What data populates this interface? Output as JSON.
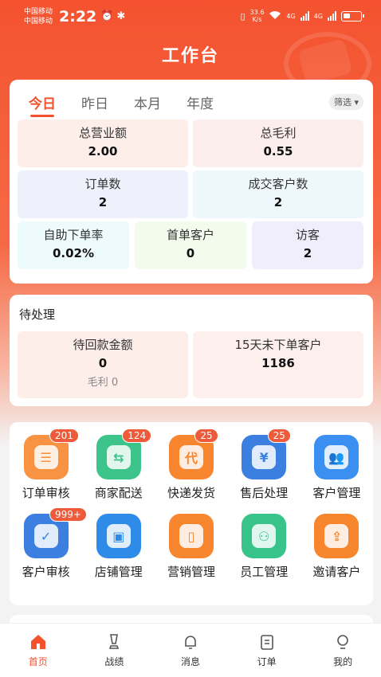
{
  "status_bar": {
    "carrier_line1": "中国移动",
    "carrier_line2": "中国移动",
    "time": "2:22",
    "speed_value": "33.6",
    "speed_unit": "K/s",
    "network1": "4G",
    "network2": "4G"
  },
  "header": {
    "title": "工作台"
  },
  "summary": {
    "tabs": [
      {
        "label": "今日",
        "active": true
      },
      {
        "label": "昨日",
        "active": false
      },
      {
        "label": "本月",
        "active": false
      },
      {
        "label": "年度",
        "active": false
      }
    ],
    "filter_label": "筛选",
    "stats": [
      {
        "label": "总营业额",
        "value": "2.00",
        "color": "#fdeeea"
      },
      {
        "label": "总毛利",
        "value": "0.55",
        "color": "#fdeeee"
      },
      {
        "label": "订单数",
        "value": "2",
        "color": "#eef0fc"
      },
      {
        "label": "成交客户数",
        "value": "2",
        "color": "#eef7fb"
      },
      {
        "label": "自助下单率",
        "value": "0.02%",
        "color": "#eefbfc"
      },
      {
        "label": "首单客户",
        "value": "0",
        "color": "#f2fbec"
      },
      {
        "label": "访客",
        "value": "2",
        "color": "#f1eefc"
      }
    ]
  },
  "pending": {
    "title": "待处理",
    "items": [
      {
        "label": "待回款金额",
        "value": "0",
        "sub": "毛利 0"
      },
      {
        "label": "15天未下单客户",
        "value": "1186"
      }
    ]
  },
  "apps": [
    {
      "label": "订单审核",
      "badge": "201",
      "icon": "order-review-icon",
      "glyph": "☰",
      "color": "#f79342"
    },
    {
      "label": "商家配送",
      "badge": "124",
      "icon": "merchant-delivery-icon",
      "glyph": "⇆",
      "color": "#3cc48a"
    },
    {
      "label": "快递发货",
      "badge": "25",
      "icon": "express-shipping-icon",
      "glyph": "代",
      "color": "#f7862f"
    },
    {
      "label": "售后处理",
      "badge": "25",
      "icon": "after-sales-icon",
      "glyph": "¥",
      "color": "#3b7fe0"
    },
    {
      "label": "客户管理",
      "badge": "",
      "icon": "customer-management-icon",
      "glyph": "👥",
      "color": "#3b8ff0"
    },
    {
      "label": "客户审核",
      "badge": "999+",
      "icon": "customer-review-icon",
      "glyph": "✓",
      "color": "#3b7fe0"
    },
    {
      "label": "店铺管理",
      "badge": "",
      "icon": "store-management-icon",
      "glyph": "▣",
      "color": "#2f8be8"
    },
    {
      "label": "营销管理",
      "badge": "",
      "icon": "marketing-management-icon",
      "glyph": "▯",
      "color": "#f7862f"
    },
    {
      "label": "员工管理",
      "badge": "",
      "icon": "staff-management-icon",
      "glyph": "⚇",
      "color": "#38c38b"
    },
    {
      "label": "邀请客户",
      "badge": "",
      "icon": "invite-customer-icon",
      "glyph": "⇪",
      "color": "#f7862f"
    }
  ],
  "tabbar": [
    {
      "label": "首页",
      "icon": "home-icon",
      "active": true
    },
    {
      "label": "战绩",
      "icon": "trophy-icon",
      "active": false
    },
    {
      "label": "消息",
      "icon": "bell-icon",
      "active": false
    },
    {
      "label": "订单",
      "icon": "clipboard-icon",
      "active": false
    },
    {
      "label": "我的",
      "icon": "profile-icon",
      "active": false
    }
  ],
  "colors": {
    "accent": "#f4522f"
  }
}
